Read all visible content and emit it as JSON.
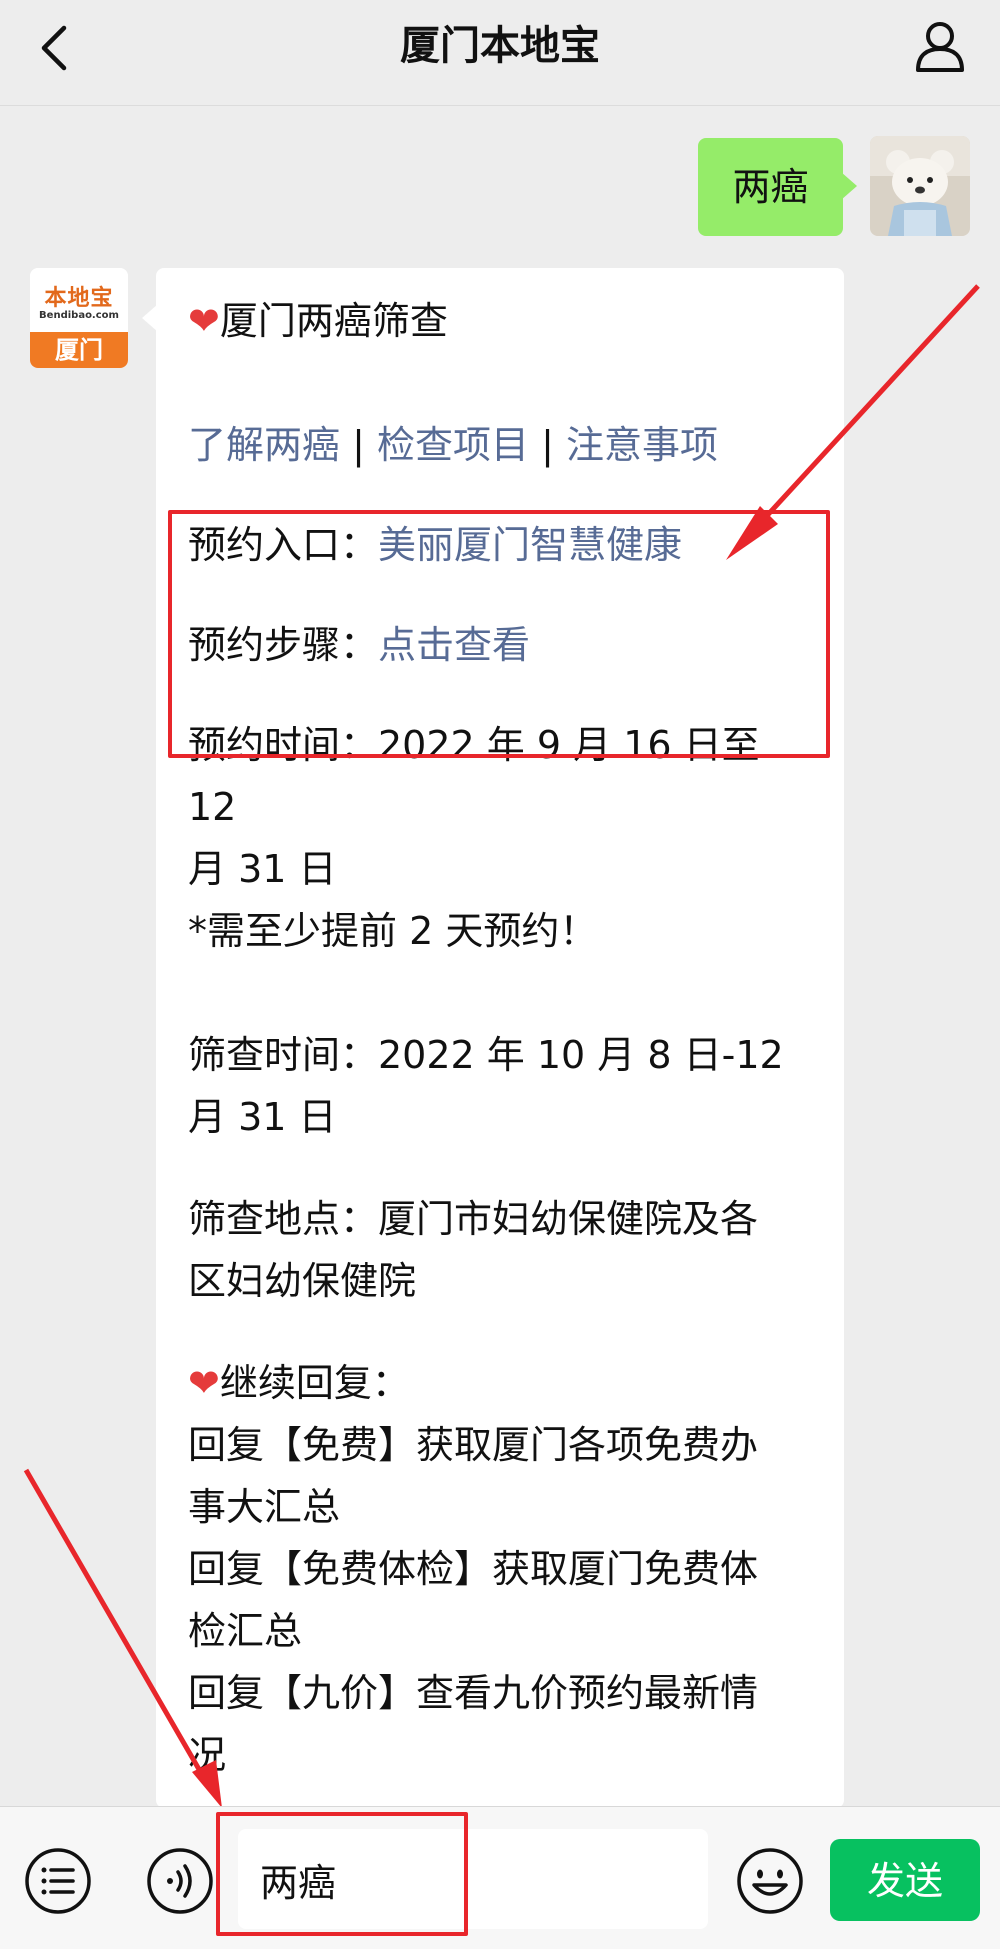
{
  "header": {
    "title": "厦门本地宝",
    "back_icon": "chevron-left-icon",
    "profile_icon": "person-icon"
  },
  "messages": {
    "outgoing": {
      "text": "两癌"
    },
    "bot_avatar": {
      "brand": "本地宝",
      "site": "Bendibao.com",
      "city": "厦门"
    },
    "reply": {
      "title": "厦门两癌筛查",
      "links": [
        "了解两癌",
        "检查项目",
        "注意事项"
      ],
      "separator": "|",
      "booking_entry_label": "预约入口：",
      "booking_entry_link": "美丽厦门智慧健康",
      "booking_steps_label": "预约步骤：",
      "booking_steps_link": "点击查看",
      "booking_time_line1": "预约时间：2022 年 9 月 16 日至 12",
      "booking_time_line2": "月 31 日",
      "booking_note": "*需至少提前 2 天预约！",
      "screening_time_line1": "筛查时间：2022 年 10 月 8 日-12",
      "screening_time_line2": "月 31 日",
      "location_line1": "筛查地点：厦门市妇幼保健院及各",
      "location_line2": "区妇幼保健院",
      "continue_title": "继续回复：",
      "reply1_line1": "回复【免费】获取厦门各项免费办",
      "reply1_line2": "事大汇总",
      "reply2_line1": "回复【免费体检】获取厦门免费体",
      "reply2_line2": "检汇总",
      "reply3_line1": "回复【九价】查看九价预约最新情",
      "reply3_line2": "况"
    }
  },
  "bottom_bar": {
    "input_value": "两癌",
    "send_label": "发送",
    "menu_icon": "menu-list-icon",
    "voice_icon": "voice-icon",
    "emoji_icon": "emoji-icon"
  },
  "colors": {
    "link": "#576b95",
    "outgoing_bubble": "#95ec69",
    "send_button": "#07c160",
    "highlight": "#e8262b"
  }
}
